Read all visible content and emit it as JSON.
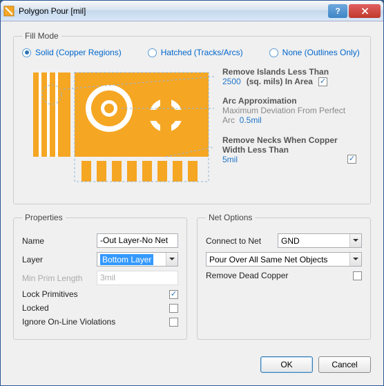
{
  "window": {
    "title": "Polygon Pour [mil]"
  },
  "fill": {
    "legend": "Fill Mode",
    "solid": "Solid (Copper Regions)",
    "hatched": "Hatched (Tracks/Arcs)",
    "none": "None (Outlines Only)",
    "selected": "solid"
  },
  "annot": {
    "islands_hd": "Remove Islands Less Than",
    "islands_val": "2500",
    "islands_unit": "(sq. mils)  In Area",
    "islands_checked": true,
    "arc_hd": "Arc Approximation",
    "arc_sub": "Maximum Deviation From Perfect Arc",
    "arc_val": "0.5mil",
    "necks_hd": "Remove Necks When Copper Width Less Than",
    "necks_val": "5mil",
    "necks_checked": true
  },
  "props": {
    "legend": "Properties",
    "name_lbl": "Name",
    "name_val": "-Out Layer-No Net",
    "layer_lbl": "Layer",
    "layer_val": "Bottom Layer",
    "minprim_lbl": "Min Prim Length",
    "minprim_val": "3mil",
    "lockprims_lbl": "Lock Primitives",
    "lockprims_checked": true,
    "locked_lbl": "Locked",
    "locked_checked": false,
    "ignore_lbl": "Ignore On-Line Violations",
    "ignore_checked": false
  },
  "net": {
    "legend": "Net Options",
    "connect_lbl": "Connect to Net",
    "connect_val": "GND",
    "mode_val": "Pour Over All Same Net Objects",
    "deadcopper_lbl": "Remove Dead Copper",
    "deadcopper_checked": false
  },
  "buttons": {
    "ok": "OK",
    "cancel": "Cancel"
  }
}
